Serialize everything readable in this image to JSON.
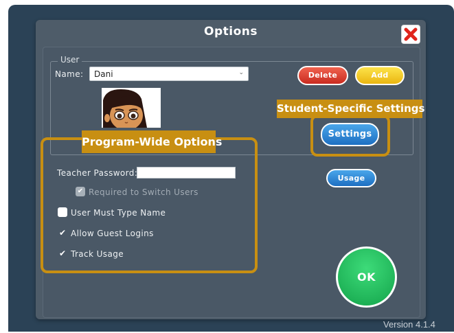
{
  "dialog": {
    "title": "Options",
    "close_icon": "close-x-icon"
  },
  "user": {
    "group_label": "User",
    "name_label": "Name:",
    "name_value": "Dani",
    "delete_label": "Delete",
    "add_label": "Add",
    "settings_label": "Settings",
    "usage_label": "Usage"
  },
  "options": {
    "teacher_password_label": "Teacher Password:",
    "teacher_password_value": "",
    "required_switch_label": "Required to Switch Users",
    "must_type_name_label": "User Must Type Name",
    "guest_logins_label": "Allow Guest Logins",
    "track_usage_label": "Track Usage",
    "required_switch_checked": true,
    "must_type_name_checked": false,
    "guest_logins_checked": true,
    "track_usage_checked": true
  },
  "ok_label": "OK",
  "callouts": {
    "student_specific": "Student-Specific Settings",
    "program_wide": "Program-Wide Options"
  },
  "version": "Version 4.1.4",
  "colors": {
    "callout": "#c88f12",
    "delete": "#d9382b",
    "add": "#f7cf2a",
    "settings": "#2a86d8",
    "ok": "#22c55e",
    "close": "#e0241b"
  }
}
